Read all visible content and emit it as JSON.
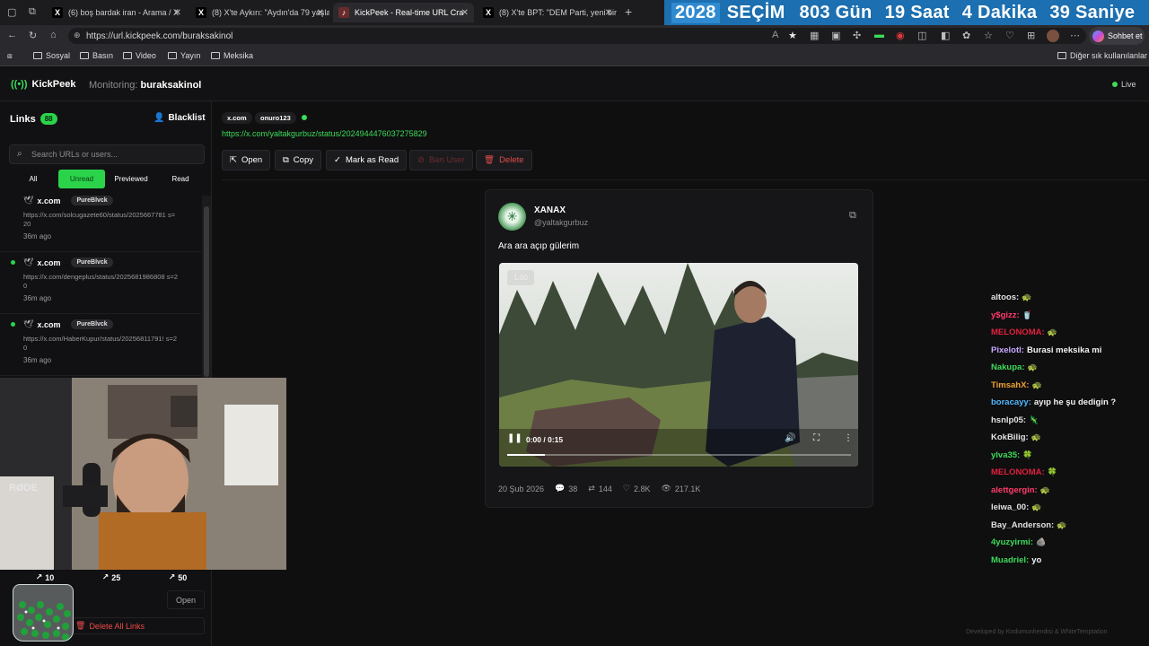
{
  "browser": {
    "tabs": [
      {
        "label": "(6) boş bardak iran - Arama / X",
        "icon": "X"
      },
      {
        "label": "(8) X'te Aykırı: \"Aydın'da 79 yaşlar",
        "icon": "X"
      },
      {
        "label": "KickPeek - Real-time URL Cra",
        "icon": "K"
      },
      {
        "label": "(8) X'te BPT: \"DEM Parti, yeni bir i",
        "icon": "X"
      }
    ],
    "countdown": {
      "year": "2028",
      "label": "SEÇİM",
      "days": "803 Gün",
      "hours": "19 Saat",
      "minutes": "4 Dakika",
      "seconds": "39 Saniye"
    },
    "url": "https://url.kickpeek.com/buraksakinol",
    "chat_button": "Sohbet et",
    "bookmarks": [
      "Sosyal",
      "Basın",
      "Video",
      "Yayın",
      "Meksika"
    ],
    "other_bookmarks": "Diğer sık kullanılanlar"
  },
  "app": {
    "logo": "KickPeek",
    "monitoring_label": "Monitoring:",
    "monitoring_user": "buraksakinol",
    "live_label": "Live",
    "accent_color": "#2bd34a"
  },
  "sidebar": {
    "title": "Links",
    "count": "88",
    "blacklist": "Blacklist",
    "search_placeholder": "Search URLs or users...",
    "filters": [
      "All",
      "Unread",
      "Previewed",
      "Read"
    ],
    "items": [
      {
        "source": "x.com",
        "user": "PureBlvck",
        "url": "https://x.com/solcugazete60/status/2025667781 s=20",
        "time": "36m ago"
      },
      {
        "source": "x.com",
        "user": "PureBlvck",
        "url": "https://x.com/dengeplus/status/2025681986808 s=20",
        "time": "36m ago"
      },
      {
        "source": "x.com",
        "user": "PureBlvck",
        "url": "https://x.com/HaberKupur/status/20256811791! s=20",
        "time": "36m ago"
      }
    ],
    "stats": [
      "10",
      "25",
      "50"
    ],
    "open_label": "Open",
    "delete_all": "Delete All Links"
  },
  "main": {
    "source_chip": "x.com",
    "user_chip": "onuro123",
    "tweet_url": "https://x.com/yaltakgurbuz/status/2024944476037275829",
    "actions": {
      "open": "Open",
      "copy": "Copy",
      "mark_read": "Mark as Read",
      "ban_user": "Ban User",
      "delete": "Delete"
    }
  },
  "tweet": {
    "name": "XANAX",
    "handle": "@yaltakgurbuz",
    "text": "Ara ara açıp gülerim",
    "video": {
      "speed": "1.00",
      "time": "0:00 / 0:15",
      "progress": 0.11
    },
    "date": "20 Şub 2026",
    "replies": "38",
    "retweets": "144",
    "likes": "2.8K",
    "views": "217.1K"
  },
  "chat": [
    {
      "user": "altoos:",
      "color": "#e0e0e0",
      "msg": "",
      "emote": "🐢"
    },
    {
      "user": "y$gizz:",
      "color": "#ff3b6b",
      "msg": "",
      "emote": "🥤"
    },
    {
      "user": "MELONOMA:",
      "color": "#e0203c",
      "msg": "",
      "emote": "🐢"
    },
    {
      "user": "Pixelotl:",
      "color": "#c9a8ff",
      "msg": "Burasi meksika mi",
      "emote": ""
    },
    {
      "user": "Nakupa:",
      "color": "#3ddc5a",
      "msg": "",
      "emote": "🐢"
    },
    {
      "user": "TimsahX:",
      "color": "#f0a030",
      "msg": "",
      "emote": "🐢"
    },
    {
      "user": "boracayy:",
      "color": "#4fb8ff",
      "msg": "ayıp he şu dedigin ?",
      "emote": ""
    },
    {
      "user": "hsnlp05:",
      "color": "#e0e0e0",
      "msg": "",
      "emote": "🦎"
    },
    {
      "user": "KokBilig:",
      "color": "#e0e0e0",
      "msg": "",
      "emote": "🐢"
    },
    {
      "user": "ylva35:",
      "color": "#3ddc5a",
      "msg": "",
      "emote": "🍀"
    },
    {
      "user": "MELONOMA:",
      "color": "#e0203c",
      "msg": "",
      "emote": "🍀"
    },
    {
      "user": "alettgergin:",
      "color": "#ff3b6b",
      "msg": "",
      "emote": "🐢"
    },
    {
      "user": "leiwa_00:",
      "color": "#e0e0e0",
      "msg": "",
      "emote": "🐢"
    },
    {
      "user": "Bay_Anderson:",
      "color": "#e0e0e0",
      "msg": "",
      "emote": "🐢"
    },
    {
      "user": "4yuzyirmi:",
      "color": "#3ddc5a",
      "msg": "",
      "emote": "🪨"
    },
    {
      "user": "Muadriel:",
      "color": "#3ddc5a",
      "msg": "yo",
      "emote": ""
    }
  ],
  "footer": "Developed by Kodumunhendisi & WhiteTemptation"
}
